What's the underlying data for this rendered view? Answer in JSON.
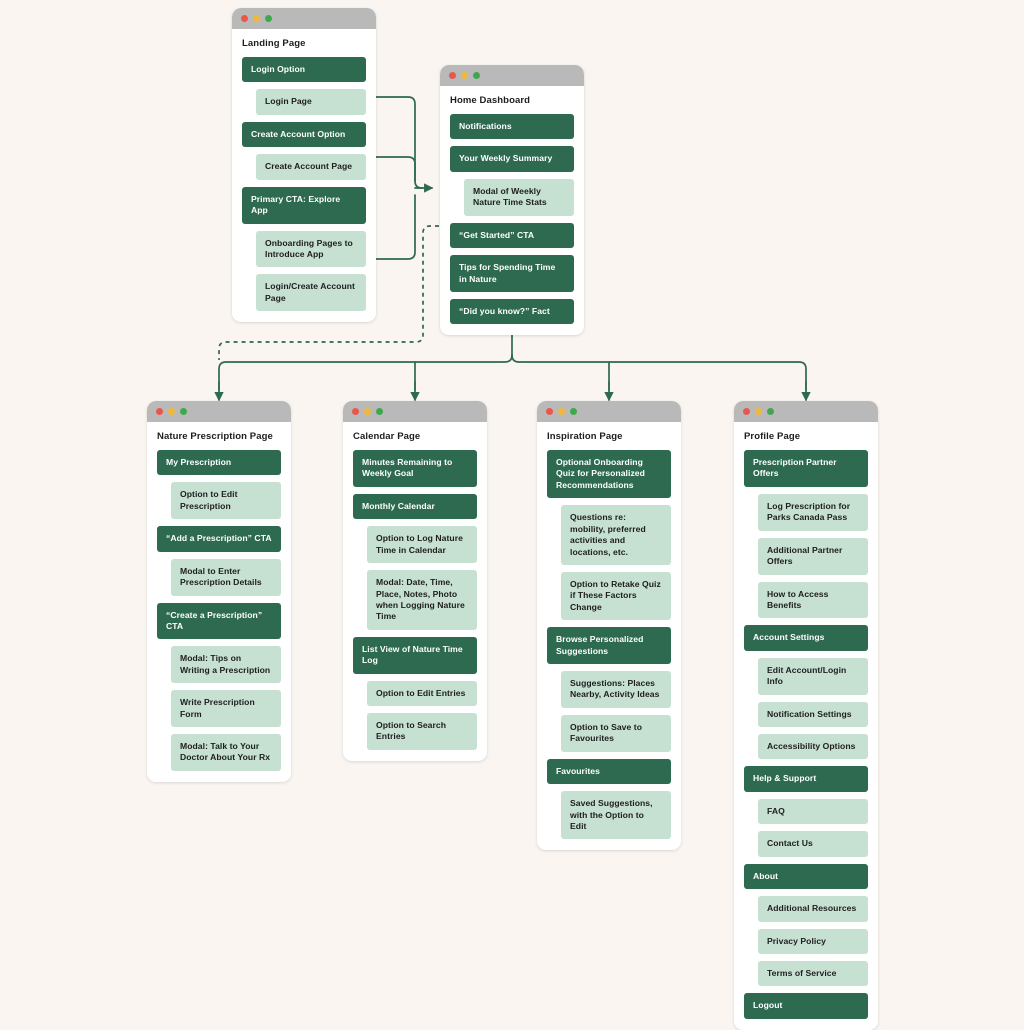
{
  "canvas": {
    "background": "#faf5f1",
    "accent_dark": "#2d6a4f",
    "accent_light": "#c6e0d1",
    "titlebar": "#b9b9b9",
    "connector": "#2d6a4f"
  },
  "windows": [
    {
      "id": "landing-page",
      "title": "Landing Page",
      "nodes": [
        {
          "label": "Login Option",
          "level": 0
        },
        {
          "label": "Login Page",
          "level": 1
        },
        {
          "label": "Create Account Option",
          "level": 0
        },
        {
          "label": "Create Account Page",
          "level": 1
        },
        {
          "label": "Primary CTA: Explore App",
          "level": 0
        },
        {
          "label": "Onboarding Pages to Introduce App",
          "level": 1
        },
        {
          "label": "Login/Create Account Page",
          "level": 1
        }
      ]
    },
    {
      "id": "home-dashboard",
      "title": "Home Dashboard",
      "nodes": [
        {
          "label": "Notifications",
          "level": 0
        },
        {
          "label": "Your Weekly Summary",
          "level": 0
        },
        {
          "label": "Modal of Weekly Nature Time Stats",
          "level": 1
        },
        {
          "label": "“Get Started” CTA",
          "level": 0
        },
        {
          "label": "Tips for Spending Time in Nature",
          "level": 0
        },
        {
          "label": "“Did you know?” Fact",
          "level": 0
        }
      ]
    },
    {
      "id": "nature-prescription-page",
      "title": "Nature Prescription Page",
      "nodes": [
        {
          "label": "My Prescription",
          "level": 0
        },
        {
          "label": "Option to Edit Prescription",
          "level": 1
        },
        {
          "label": "“Add a Prescription” CTA",
          "level": 0
        },
        {
          "label": "Modal to Enter Prescription Details",
          "level": 1
        },
        {
          "label": "“Create a Prescription” CTA",
          "level": 0
        },
        {
          "label": "Modal: Tips on Writing a Prescription",
          "level": 1
        },
        {
          "label": "Write Prescription Form",
          "level": 1
        },
        {
          "label": "Modal: Talk to Your Doctor About Your Rx",
          "level": 1
        }
      ]
    },
    {
      "id": "calendar-page",
      "title": "Calendar Page",
      "nodes": [
        {
          "label": "Minutes Remaining to Weekly Goal",
          "level": 0
        },
        {
          "label": "Monthly Calendar",
          "level": 0
        },
        {
          "label": "Option to Log Nature Time in Calendar",
          "level": 1
        },
        {
          "label": "Modal: Date, Time, Place, Notes, Photo when Logging Nature Time",
          "level": 1
        },
        {
          "label": "List View of Nature Time Log",
          "level": 0
        },
        {
          "label": "Option to Edit Entries",
          "level": 1
        },
        {
          "label": "Option to Search Entries",
          "level": 1
        }
      ]
    },
    {
      "id": "inspiration-page",
      "title": "Inspiration Page",
      "nodes": [
        {
          "label": "Optional Onboarding Quiz for Personalized Recommendations",
          "level": 0
        },
        {
          "label": "Questions re: mobility, preferred activities and locations, etc.",
          "level": 1
        },
        {
          "label": "Option to Retake Quiz if These Factors Change",
          "level": 1
        },
        {
          "label": "Browse Personalized Suggestions",
          "level": 0
        },
        {
          "label": "Suggestions: Places Nearby, Activity Ideas",
          "level": 1
        },
        {
          "label": "Option to Save to Favourites",
          "level": 1
        },
        {
          "label": "Favourites",
          "level": 0
        },
        {
          "label": "Saved Suggestions, with the Option to Edit",
          "level": 1
        }
      ]
    },
    {
      "id": "profile-page",
      "title": "Profile Page",
      "nodes": [
        {
          "label": "Prescription Partner Offers",
          "level": 0
        },
        {
          "label": "Log Prescription for Parks Canada Pass",
          "level": 1
        },
        {
          "label": "Additional Partner Offers",
          "level": 1
        },
        {
          "label": "How to Access Benefits",
          "level": 1
        },
        {
          "label": "Account Settings",
          "level": 0
        },
        {
          "label": "Edit Account/Login Info",
          "level": 1
        },
        {
          "label": "Notification Settings",
          "level": 1
        },
        {
          "label": "Accessibility Options",
          "level": 1
        },
        {
          "label": "Help & Support",
          "level": 0
        },
        {
          "label": "FAQ",
          "level": 1
        },
        {
          "label": "Contact Us",
          "level": 1
        },
        {
          "label": "About",
          "level": 0
        },
        {
          "label": "Additional Resources",
          "level": 1
        },
        {
          "label": "Privacy Policy",
          "level": 1
        },
        {
          "label": "Terms of Service",
          "level": 1
        },
        {
          "label": "Logout",
          "level": 0
        }
      ]
    }
  ]
}
